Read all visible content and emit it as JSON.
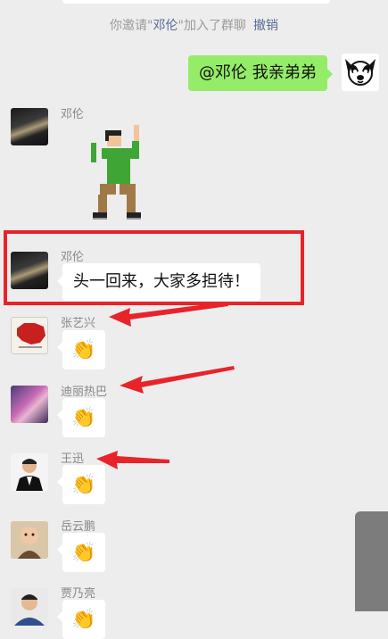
{
  "system": {
    "prefix": "你邀请\"",
    "invitee": "邓伦",
    "suffix": "\"加入了群聊",
    "revoke": "撤销"
  },
  "my_message": {
    "text": "@邓伦 我亲弟弟"
  },
  "messages": [
    {
      "sender": "邓伦",
      "content": "dancing-sticker"
    },
    {
      "sender": "邓伦",
      "text": "头一回来，大家多担待！"
    },
    {
      "sender": "张艺兴",
      "content": "clap-emoji"
    },
    {
      "sender": "迪丽热巴",
      "content": "clap-emoji"
    },
    {
      "sender": "王迅",
      "content": "clap-emoji"
    },
    {
      "sender": "岳云鹏",
      "content": "clap-emoji"
    },
    {
      "sender": "贾乃亮",
      "content": "clap-emoji"
    }
  ],
  "clap_emoji": "👏",
  "colors": {
    "background": "#ededed",
    "my_bubble": "#95ec69",
    "link": "#576b95",
    "annotation_red": "#e8232a"
  }
}
